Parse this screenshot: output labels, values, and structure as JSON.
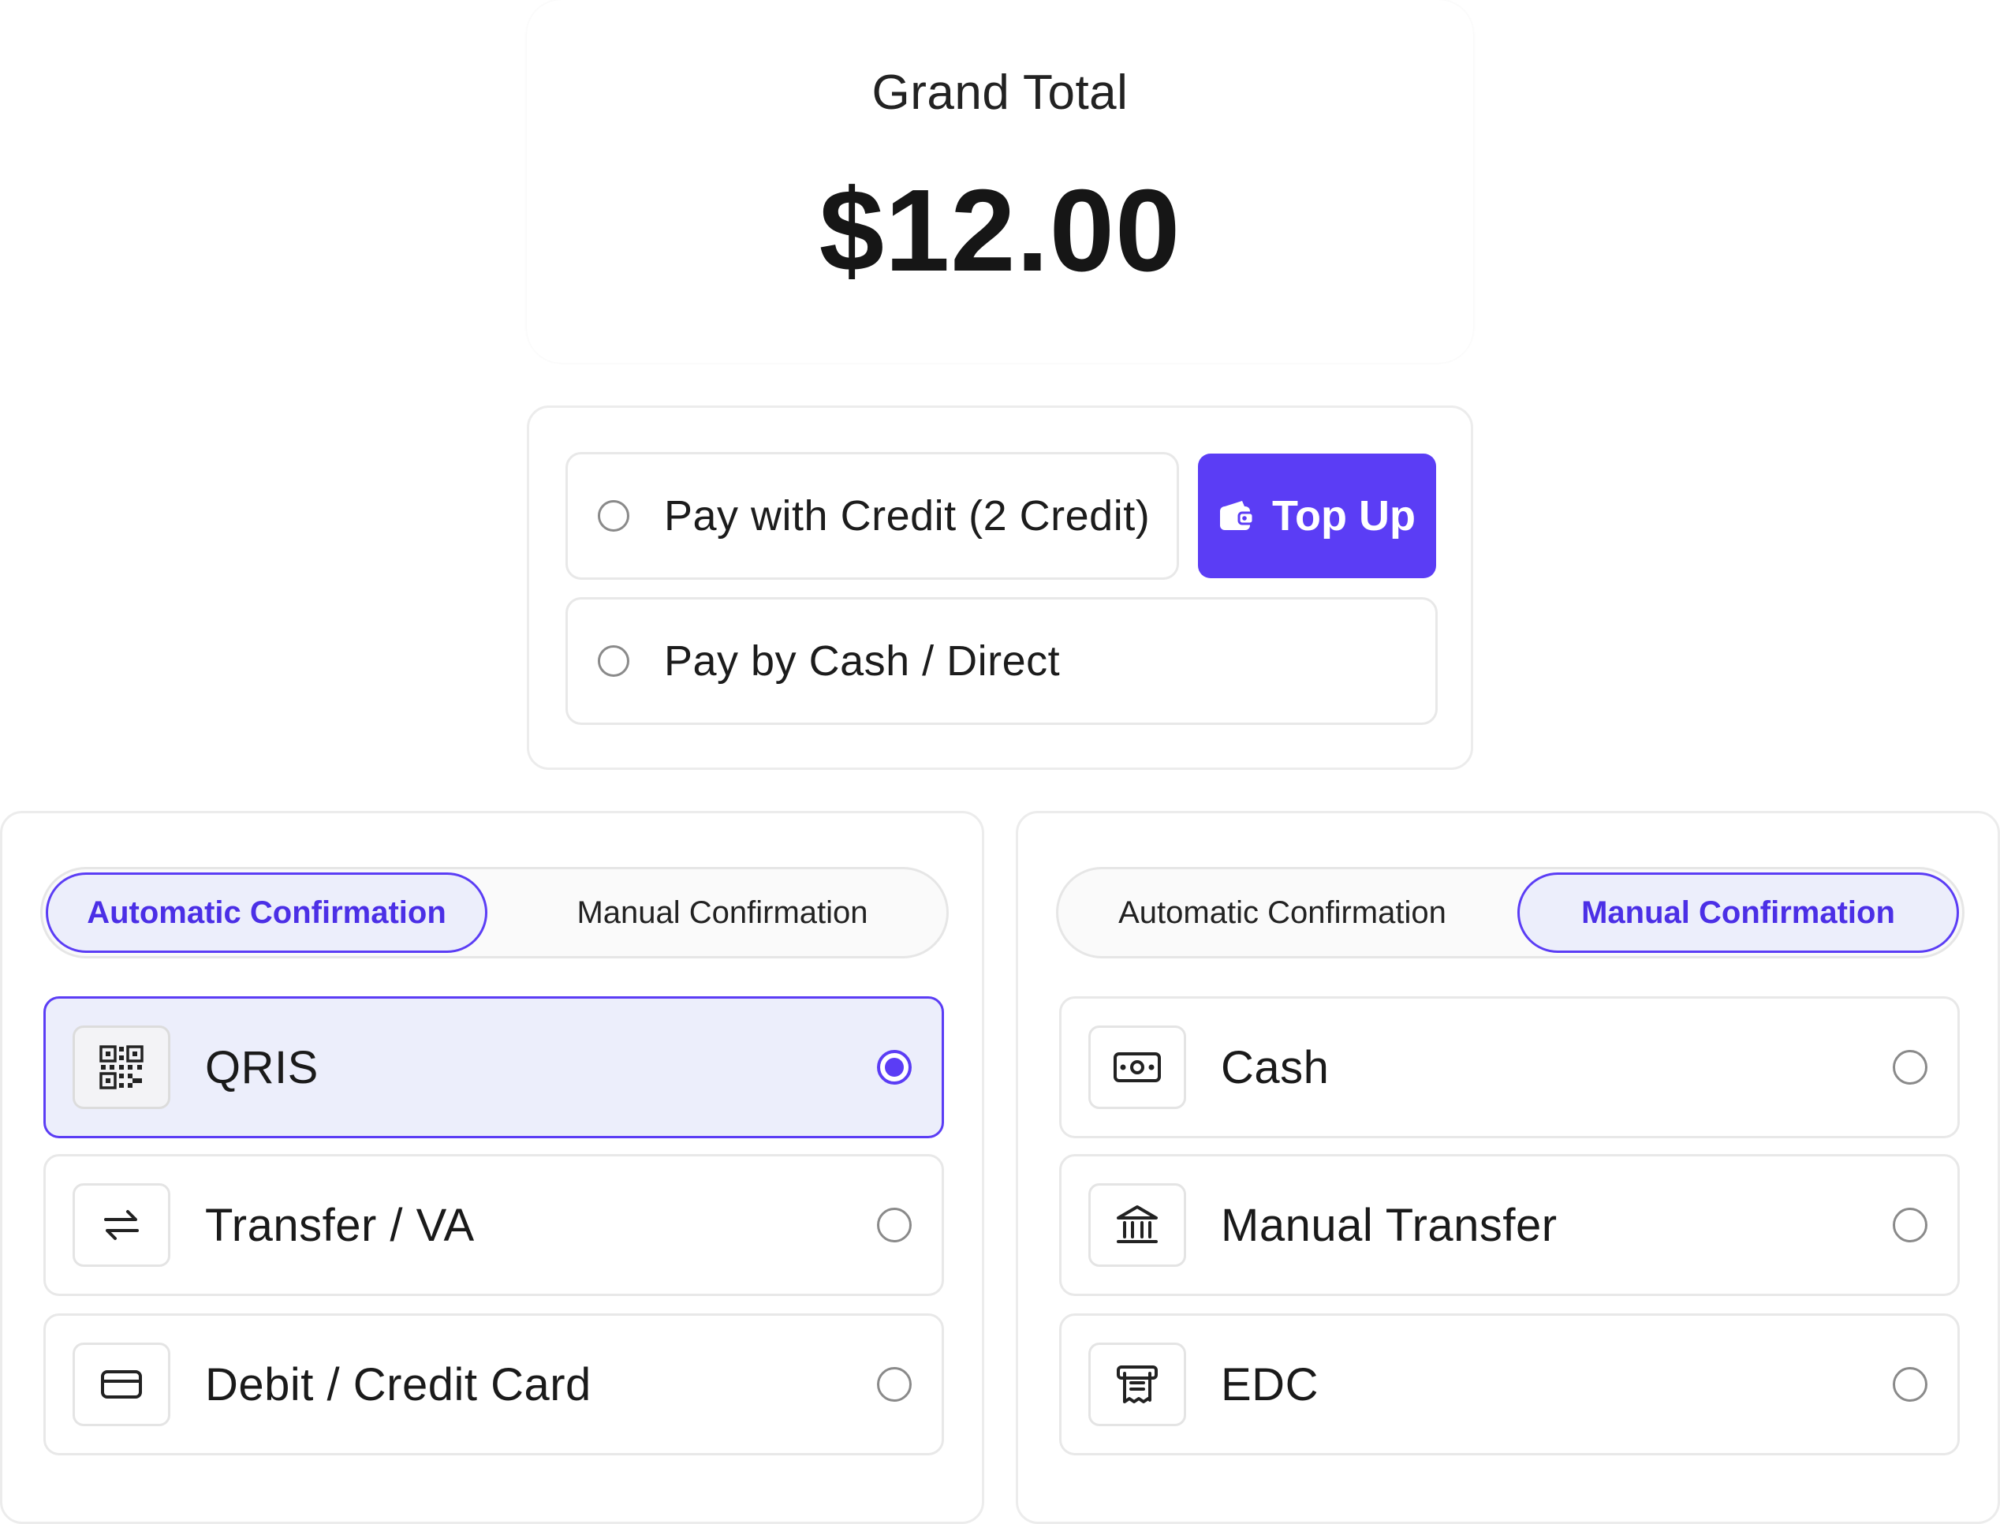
{
  "summary": {
    "label": "Grand Total",
    "amount": "$12.00"
  },
  "pay_options": {
    "credit_label": "Pay with Credit (2 Credit)",
    "cash_label": "Pay by Cash / Direct",
    "topup_label": "Top Up",
    "topup_icon": "wallet-icon"
  },
  "accent_color": "#5b3df5",
  "panels": [
    {
      "tabs": [
        {
          "label": "Automatic Confirmation",
          "active": true
        },
        {
          "label": "Manual Confirmation",
          "active": false
        }
      ],
      "methods": [
        {
          "label": "QRIS",
          "icon": "qr-code-icon",
          "selected": true
        },
        {
          "label": "Transfer / VA",
          "icon": "transfer-arrows-icon",
          "selected": false
        },
        {
          "label": "Debit / Credit Card",
          "icon": "credit-card-icon",
          "selected": false
        }
      ]
    },
    {
      "tabs": [
        {
          "label": "Automatic Confirmation",
          "active": false
        },
        {
          "label": "Manual Confirmation",
          "active": true
        }
      ],
      "methods": [
        {
          "label": "Cash",
          "icon": "banknote-icon",
          "selected": false
        },
        {
          "label": "Manual Transfer",
          "icon": "bank-icon",
          "selected": false
        },
        {
          "label": "EDC",
          "icon": "receipt-icon",
          "selected": false
        }
      ]
    }
  ]
}
